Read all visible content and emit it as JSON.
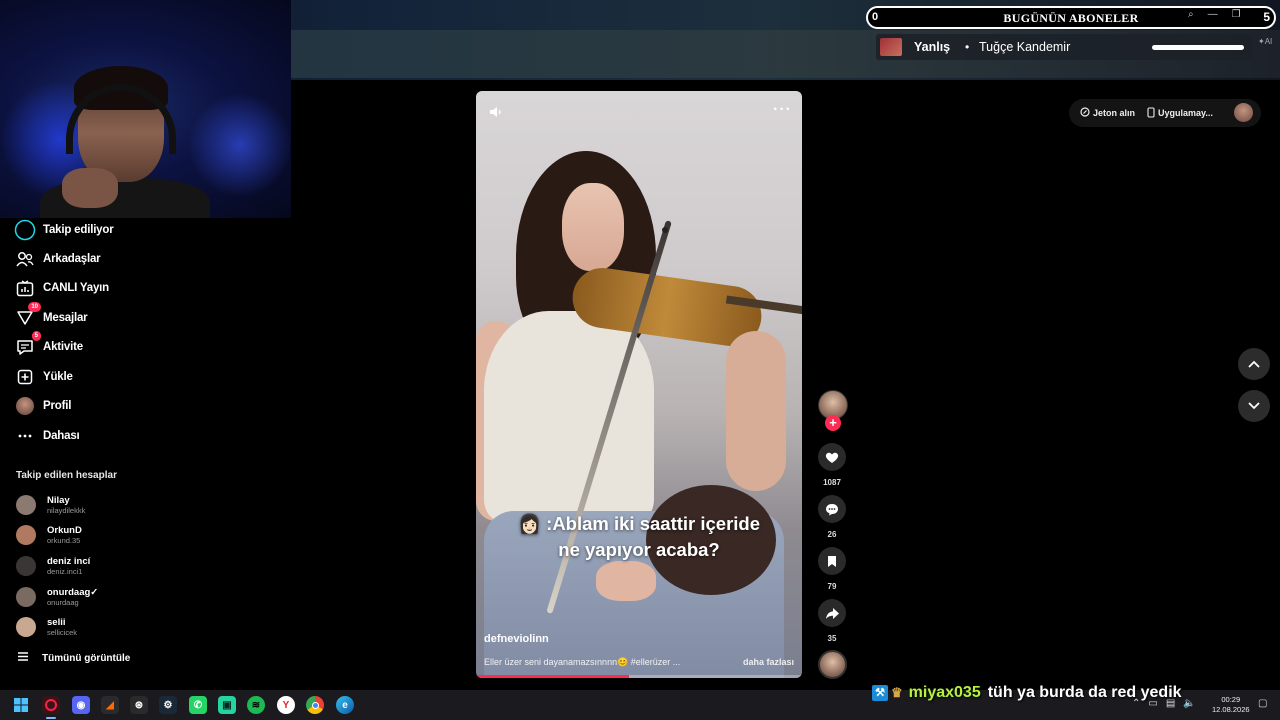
{
  "subscriber_widget": {
    "count_left": "0",
    "title": "BUGÜNÜN ABONELER",
    "count_right": "5"
  },
  "now_playing": {
    "track": "Yanlış",
    "separator": "•",
    "artist": "Tuğçe Kandemir",
    "progress": 1.0,
    "tag": "AI"
  },
  "topbar": {
    "coins_label": "Jeton alın",
    "app_label": "Uygulamay..."
  },
  "sidebar": {
    "items": [
      {
        "label": "Takip ediliyor",
        "icon": "following-ring-icon"
      },
      {
        "label": "Arkadaşlar",
        "icon": "friends-icon"
      },
      {
        "label": "CANLI Yayın",
        "icon": "live-icon"
      },
      {
        "label": "Mesajlar",
        "icon": "messages-icon",
        "badge": "10"
      },
      {
        "label": "Aktivite",
        "icon": "activity-icon",
        "badge": "5"
      },
      {
        "label": "Yükle",
        "icon": "upload-icon"
      },
      {
        "label": "Profil",
        "icon": "profile-avatar"
      },
      {
        "label": "Dahası",
        "icon": "more-dots-icon"
      }
    ],
    "followed_title": "Takip edilen hesaplar",
    "accounts": [
      {
        "name": "Nilay",
        "handle": "nilaydilekkk",
        "color": "#8a7a70"
      },
      {
        "name": "OrkunD",
        "handle": "orkund.35",
        "color": "#b07a60"
      },
      {
        "name": "deniz incí",
        "handle": "deniz.inci1",
        "color": "#3a3636"
      },
      {
        "name": "onurdaag✓",
        "handle": "onurdaag",
        "color": "#7a6a62"
      },
      {
        "name": "selii",
        "handle": "sellicicek",
        "color": "#c8a890"
      }
    ],
    "see_all": "Tümünü görüntüle"
  },
  "video": {
    "caption_line1": "Ablam iki saattir içeride",
    "caption_line2": "ne yapıyor acaba?",
    "username": "defneviolinn",
    "description": "Eller üzer seni dayanamazsınnnn😊 #ellerüzer ...",
    "more_link": "daha fazlası",
    "progress": 0.47
  },
  "actions": {
    "likes": "1087",
    "comments": "26",
    "saves": "79",
    "shares": "35"
  },
  "chat": {
    "user": "miyax035",
    "message": "tüh ya burda da red yedik"
  },
  "clock": {
    "time": "00:29",
    "date": "12.08.2026"
  },
  "colors": {
    "accent": "#fe2c55",
    "chat_user": "#b6f23c"
  }
}
